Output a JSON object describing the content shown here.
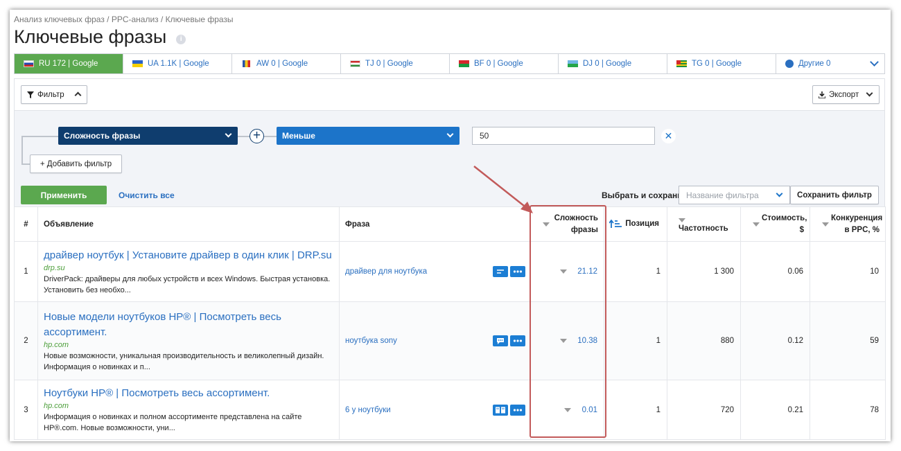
{
  "breadcrumb": "Анализ ключевых фраз / PPC-анализ / Ключевые фразы",
  "page_title": "Ключевые фразы",
  "tabs": [
    {
      "label": "RU 172 | Google",
      "active": true
    },
    {
      "label": "UA 1.1K | Google"
    },
    {
      "label": "AW 0 | Google"
    },
    {
      "label": "TJ 0 | Google"
    },
    {
      "label": "BF 0 | Google"
    },
    {
      "label": "DJ 0 | Google"
    },
    {
      "label": "TG 0 | Google"
    },
    {
      "label": "Другие 0"
    }
  ],
  "toolbar": {
    "filter_label": "Фильтр",
    "export_label": "Экспорт"
  },
  "filter": {
    "field": "Сложность фразы",
    "operator": "Меньше",
    "value": "50",
    "add_filter_label": "+ Добавить фильтр",
    "apply_label": "Применить",
    "clear_label": "Очистить все",
    "choose_save_label": "Выбрать и сохранить",
    "filter_name_placeholder": "Название фильтра",
    "save_filter_label": "Сохранить фильтр"
  },
  "table": {
    "headers": {
      "num": "#",
      "ad": "Объявление",
      "phrase": "Фраза",
      "difficulty": "Сложность фразы",
      "position": "Позиция",
      "frequency": "Частотность",
      "cost": "Стоимость, $",
      "competition": "Конкуренция в PPC, %"
    },
    "rows": [
      {
        "num": "1",
        "title": "драйвер ноутбук | Установите драйвер в один клик | DRP.su",
        "domain": "drp.su",
        "desc": "DriverPack: драйверы для любых устройств и всех Windows. Быстрая установка. Установить без необхо...",
        "phrase": "драйвер для ноутбука",
        "difficulty": "21.12",
        "position": "1",
        "frequency": "1 300",
        "cost": "0.06",
        "competition": "10"
      },
      {
        "num": "2",
        "title": "Новые модели ноутбуков HP® | Посмотреть весь ассортимент.",
        "domain": "hp.com",
        "desc": "Новые возможности, уникальная производительность и великолепный дизайн. Информация о новинках и п...",
        "phrase": "ноутбука sony",
        "difficulty": "10.38",
        "position": "1",
        "frequency": "880",
        "cost": "0.12",
        "competition": "59"
      },
      {
        "num": "3",
        "title": "Ноутбуки HP® | Посмотреть весь ассортимент.",
        "domain": "hp.com",
        "desc": "Информация о новинках и полном ассортименте представлена на сайте HP®.com. Новые возможности, уни...",
        "phrase": "6 у ноутбуки",
        "difficulty": "0.01",
        "position": "1",
        "frequency": "720",
        "cost": "0.21",
        "competition": "78"
      }
    ]
  },
  "colors": {
    "green": "#5ba84f",
    "blue_link": "#2a6fc0",
    "dark_blue": "#0f3d6e",
    "mid_blue": "#1c74c9",
    "highlight": "#c25a5a"
  }
}
